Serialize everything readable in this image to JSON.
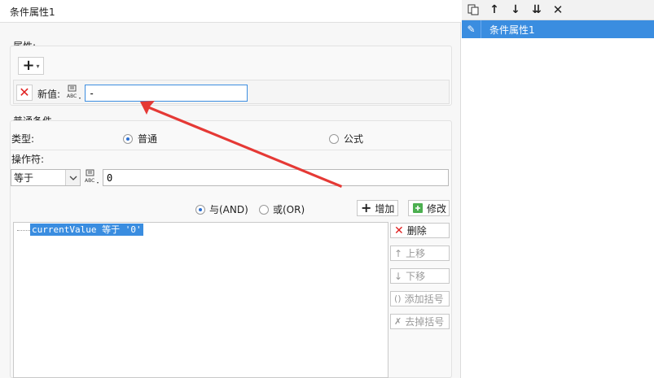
{
  "title": "条件属性1",
  "attributes": {
    "label": "属性:",
    "new_value_label": "新值:",
    "new_value": "-"
  },
  "condition": {
    "label": "普通条件",
    "type_label": "类型:",
    "type_options": [
      "普通",
      "公式"
    ],
    "type_selected": "普通",
    "operator_label": "操作符:",
    "operator_value": "等于",
    "operand_value": "0"
  },
  "logic": {
    "and_label": "与(AND)",
    "or_label": "或(OR)",
    "selected": "and"
  },
  "actions": {
    "add": "增加",
    "modify": "修改",
    "delete": "删除",
    "move_up": "上移",
    "move_down": "下移",
    "add_bracket": "添加括号",
    "remove_bracket": "去掉括号"
  },
  "condition_list": [
    "currentValue 等于 '0'"
  ],
  "right_panel": {
    "items": [
      "条件属性1"
    ]
  },
  "colors": {
    "accent": "#3a8de0",
    "arrow": "#e53935",
    "delete_red": "#e02020"
  }
}
